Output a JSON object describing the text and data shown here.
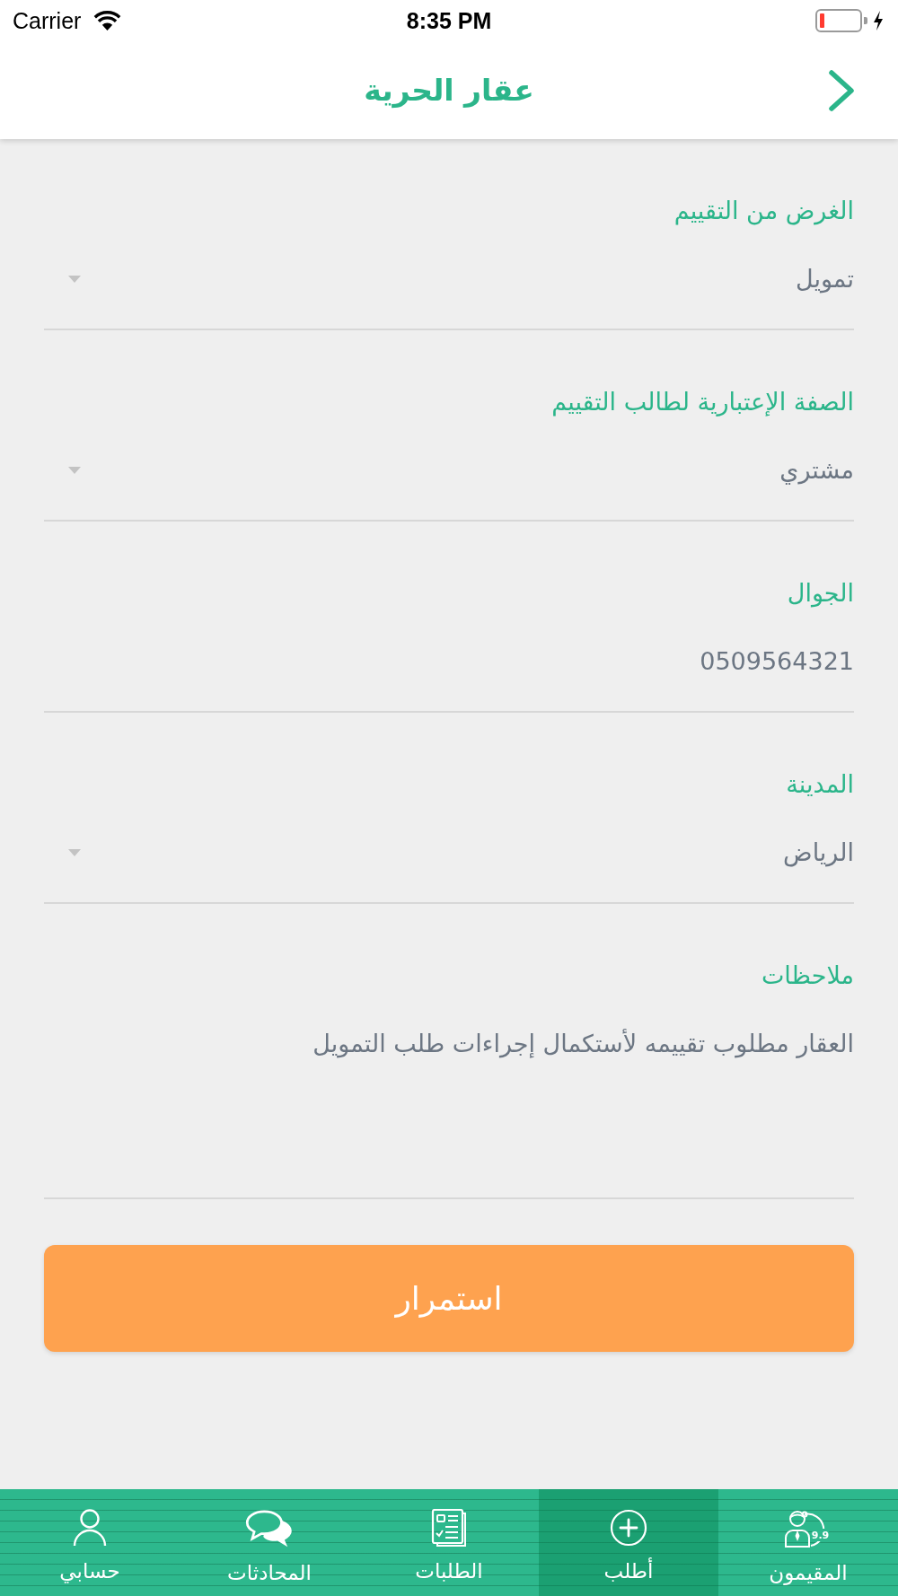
{
  "status_bar": {
    "carrier": "Carrier",
    "time": "8:35 PM"
  },
  "header": {
    "title": "عقار الحرية"
  },
  "form": {
    "fields": [
      {
        "kind": "dropdown",
        "label": "الغرض من التقييم",
        "value": "تمويل"
      },
      {
        "kind": "dropdown",
        "label": "الصفة الإعتبارية لطالب التقييم",
        "value": "مشتري"
      },
      {
        "kind": "text",
        "label": "الجوال",
        "value": "0509564321"
      },
      {
        "kind": "dropdown",
        "label": "المدينة",
        "value": "الرياض"
      },
      {
        "kind": "textarea",
        "label": "ملاحظات",
        "value": "العقار مطلوب تقييمه لأستكمال إجراءات طلب التمويل"
      }
    ]
  },
  "continue_button": {
    "label": "استمرار"
  },
  "tab_bar": {
    "tabs": [
      {
        "label": "المقيمون",
        "selected": false,
        "badge": "9.9"
      },
      {
        "label": "أطلب",
        "selected": true
      },
      {
        "label": "الطلبات",
        "selected": false
      },
      {
        "label": "المحادثات",
        "selected": false
      },
      {
        "label": "حسابي",
        "selected": false
      }
    ]
  }
}
